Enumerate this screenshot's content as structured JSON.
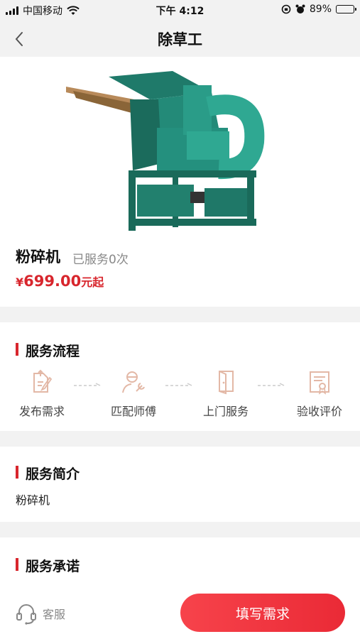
{
  "status_bar": {
    "carrier": "中国移动",
    "time": "下午 4:12",
    "battery": "89%",
    "battery_level": 0.89
  },
  "nav": {
    "title": "除草工"
  },
  "product": {
    "name": "粉碎机",
    "served": "已服务0次",
    "price_symbol": "¥",
    "price_amount": "699.00",
    "price_suffix": "元起"
  },
  "process": {
    "title": "服务流程",
    "steps": [
      {
        "label": "发布需求",
        "icon": "edit-doc-icon"
      },
      {
        "label": "匹配师傅",
        "icon": "worker-wrench-icon"
      },
      {
        "label": "上门服务",
        "icon": "door-icon"
      },
      {
        "label": "验收评价",
        "icon": "certificate-icon"
      }
    ]
  },
  "intro": {
    "title": "服务简介",
    "text": "粉碎机"
  },
  "promise": {
    "title": "服务承诺"
  },
  "bottom": {
    "service_label": "客服",
    "request_label": "填写需求"
  },
  "colors": {
    "accent": "#d8262d",
    "icon_tint": "#e3b8a6"
  }
}
